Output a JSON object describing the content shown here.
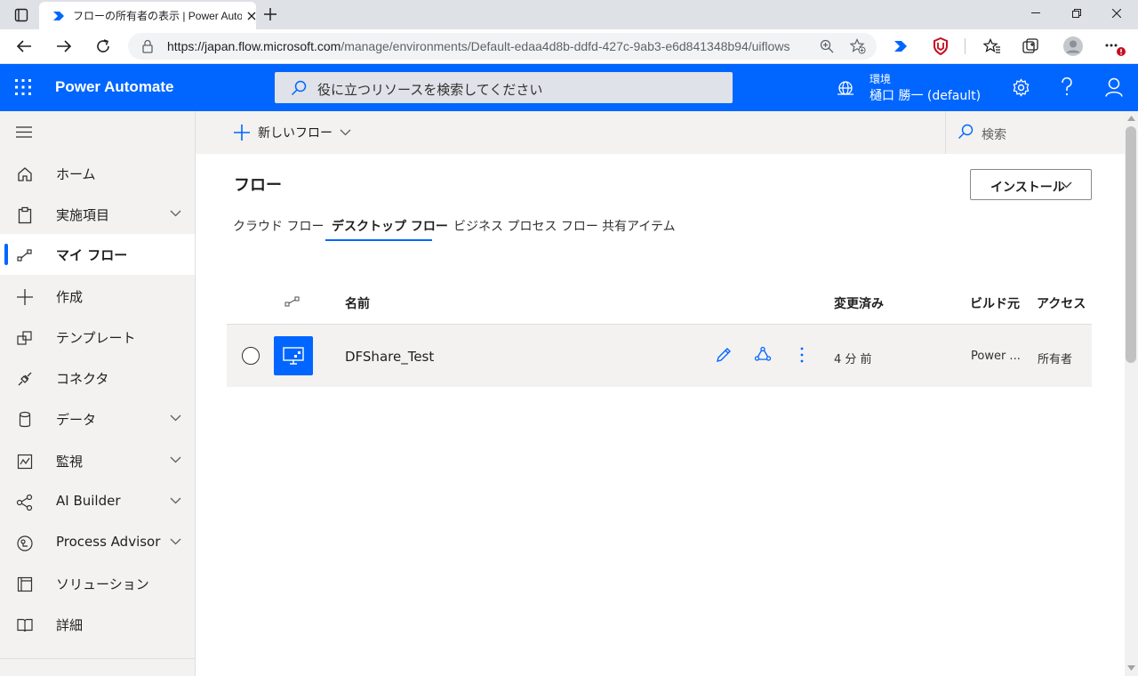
{
  "browser": {
    "tab_title": "フローの所有者の表示 | Power Automate",
    "url_host": "https://japan.flow.microsoft.com",
    "url_path": "/manage/environments/Default-edaa4d8b-ddfd-427c-9ab3-e6d841348b94/uiflows"
  },
  "header": {
    "app_name": "Power Automate",
    "search_placeholder": "役に立つリソースを検索してください",
    "env_label": "環境",
    "env_name": "樋口 勝一 (default)",
    "brand_color": "#0066ff"
  },
  "sidebar": {
    "items": [
      {
        "label": "ホーム",
        "icon": "home-icon",
        "expandable": false
      },
      {
        "label": "実施項目",
        "icon": "clipboard-icon",
        "expandable": true
      },
      {
        "label": "マイ フロー",
        "icon": "flow-icon",
        "expandable": false,
        "active": true
      },
      {
        "label": "作成",
        "icon": "plus-icon",
        "expandable": false
      },
      {
        "label": "テンプレート",
        "icon": "template-icon",
        "expandable": false
      },
      {
        "label": "コネクタ",
        "icon": "connector-icon",
        "expandable": false
      },
      {
        "label": "データ",
        "icon": "database-icon",
        "expandable": true
      },
      {
        "label": "監視",
        "icon": "monitor-icon",
        "expandable": true
      },
      {
        "label": "AI Builder",
        "icon": "ai-builder-icon",
        "expandable": true
      },
      {
        "label": "Process Advisor",
        "icon": "process-advisor-icon",
        "expandable": true
      },
      {
        "label": "ソリューション",
        "icon": "solution-icon",
        "expandable": false
      },
      {
        "label": "詳細",
        "icon": "book-icon",
        "expandable": false
      }
    ]
  },
  "commandbar": {
    "new_flow_label": "新しいフロー",
    "search_placeholder": "検索"
  },
  "main": {
    "title": "フロー",
    "install_label": "インストール",
    "tabs": [
      {
        "label": "クラウド フロー"
      },
      {
        "label": "デスクトップ フロー",
        "active": true
      },
      {
        "label": "ビジネス プロセス フロー"
      },
      {
        "label": "共有アイテム"
      }
    ],
    "columns": {
      "name": "名前",
      "modified": "変更済み",
      "built_with": "ビルド元",
      "access": "アクセス"
    },
    "rows": [
      {
        "name": "DFShare_Test",
        "modified": "4 分 前",
        "built_with": "Power ...",
        "access": "所有者"
      }
    ]
  }
}
